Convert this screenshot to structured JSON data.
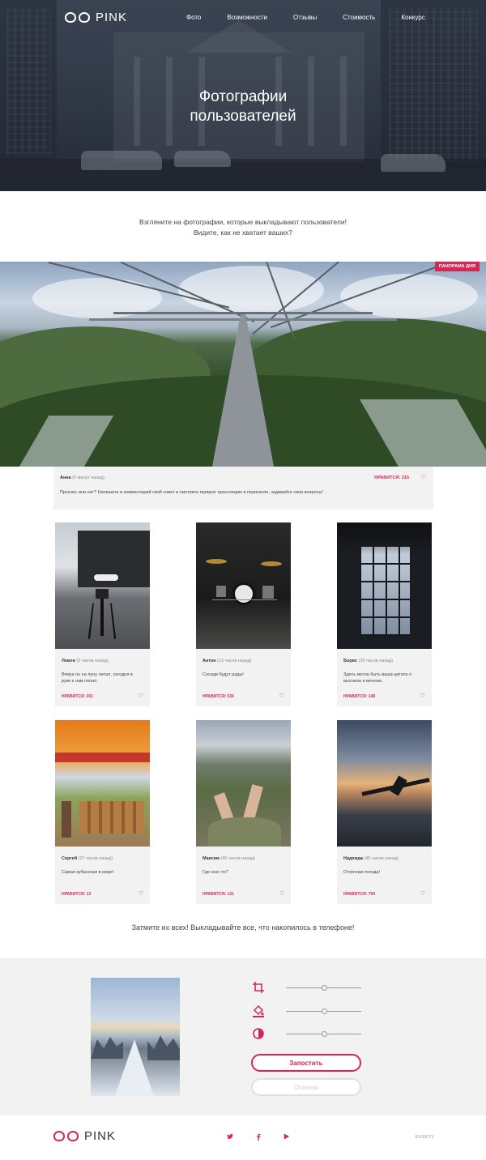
{
  "brand": {
    "name": "PINK",
    "icon": "glasses-logo-icon",
    "accent": "#d22856"
  },
  "nav": [
    "Фото",
    "Возможности",
    "Отзывы",
    "Стоимость",
    "Конкурс"
  ],
  "hero": {
    "title_line1": "Фотографии",
    "title_line2": "пользователей"
  },
  "intro": {
    "line1": "Взгляните на фотографии, которые выкладывают пользователи!",
    "line2": "Видите, как не хватает ваших?"
  },
  "panorama": {
    "badge": "панорама дня",
    "author": "Анна",
    "time": "(5 минут назад)",
    "likes": "НРАВИТСЯ: 215",
    "text": "Прыгать или нет? Напишите в комментарий свой совет и смотрите прямую трансляцию в перископе, задавайте свои вопросы!"
  },
  "cards": [
    {
      "author": "Левон",
      "time": "(5 часов назад)",
      "text": "Вчера он на луну летал, сегодня в руки к нам попал.",
      "likes": "НРАВИТСЯ: 201"
    },
    {
      "author": "Антон",
      "time": "(12 часов назад)",
      "text": "Соседи будут рады!",
      "likes": "НРАВИТСЯ: 536"
    },
    {
      "author": "Борис",
      "time": "(20 часов назад)",
      "text": "Здесь могла быть ваша цитата о высоком и вечном.",
      "likes": "НРАВИТСЯ: 148"
    },
    {
      "author": "Сергей",
      "time": "(27 часов назад)",
      "text": "Самая кубанская в мире!",
      "likes": "НРАВИТСЯ: 13"
    },
    {
      "author": "Максим",
      "time": "(40 часов назад)",
      "text": "Где снег-то?",
      "likes": "НРАВИТСЯ: 131"
    },
    {
      "author": "Надежда",
      "time": "(45 часов назад)",
      "text": "Отличная погода!",
      "likes": "НРАВИТСЯ: 794"
    }
  ],
  "tagline": "Затмите их всех! Выкладывайте все, что накопилось в телефоне!",
  "editor": {
    "controls": [
      {
        "icon": "crop-icon",
        "level": 0.5
      },
      {
        "icon": "fill-icon",
        "level": 0.5
      },
      {
        "icon": "contrast-icon",
        "level": 0.5
      }
    ],
    "submit_label": "Запостить",
    "cancel_label": "Отмена"
  },
  "footer": {
    "social": [
      "twitter-icon",
      "facebook-icon",
      "youtube-icon"
    ],
    "credit": "EVGKTV"
  }
}
